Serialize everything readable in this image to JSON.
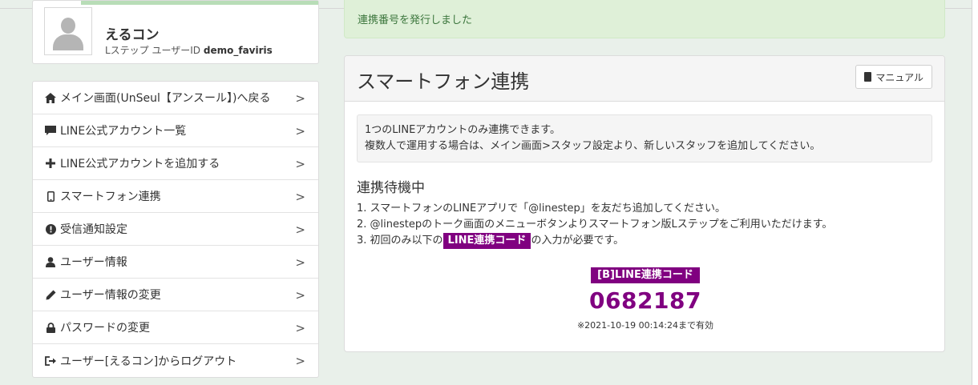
{
  "profile": {
    "name": "えるコン",
    "meta_prefix": "Lステップ ユーザーID",
    "user_id": "demo_faviris"
  },
  "menu": {
    "items": [
      {
        "icon": "home-icon",
        "label": "メイン画面(UnSeul【アンスール】)へ戻る"
      },
      {
        "icon": "comment-icon",
        "label": "LINE公式アカウント一覧"
      },
      {
        "icon": "plus-icon",
        "label": "LINE公式アカウントを追加する"
      },
      {
        "icon": "mobile-icon",
        "label": "スマートフォン連携"
      },
      {
        "icon": "exclamation-circle-icon",
        "label": "受信通知設定"
      },
      {
        "icon": "user-icon",
        "label": "ユーザー情報"
      },
      {
        "icon": "pencil-icon",
        "label": "ユーザー情報の変更"
      },
      {
        "icon": "lock-icon",
        "label": "パスワードの変更"
      },
      {
        "icon": "logout-icon",
        "label": "ユーザー[えるコン]からログアウト"
      }
    ]
  },
  "alert": {
    "text": "連携番号を発行しました"
  },
  "panel": {
    "title": "スマートフォン連携",
    "manual_label": "マニュアル",
    "info_line1": "1つのLINEアカウントのみ連携できます。",
    "info_line2": "複数人で運用する場合は、メイン画面>スタッフ設定より、新しいスタッフを追加してください。",
    "status_heading": "連携待機中",
    "step1": "1. スマートフォンのLINEアプリで「@linestep」を友だち追加してください。",
    "step2": "2. @linestepのトーク画面のメニューボタンよりスマートフォン版Lステップをご利用いただけます。",
    "step3_prefix": "3. 初回のみ以下の",
    "step3_tag": "LINE連携コード",
    "step3_suffix": "の入力が必要です。",
    "code_label": "[B]LINE連携コード",
    "code_value": "0682187",
    "code_expiry": "※2021-10-19 00:14:24まで有効"
  },
  "colors": {
    "accent_purple": "#800080",
    "alert_bg": "#dff0d8",
    "alert_text": "#3c763d",
    "page_bg": "#e9f0ea"
  }
}
